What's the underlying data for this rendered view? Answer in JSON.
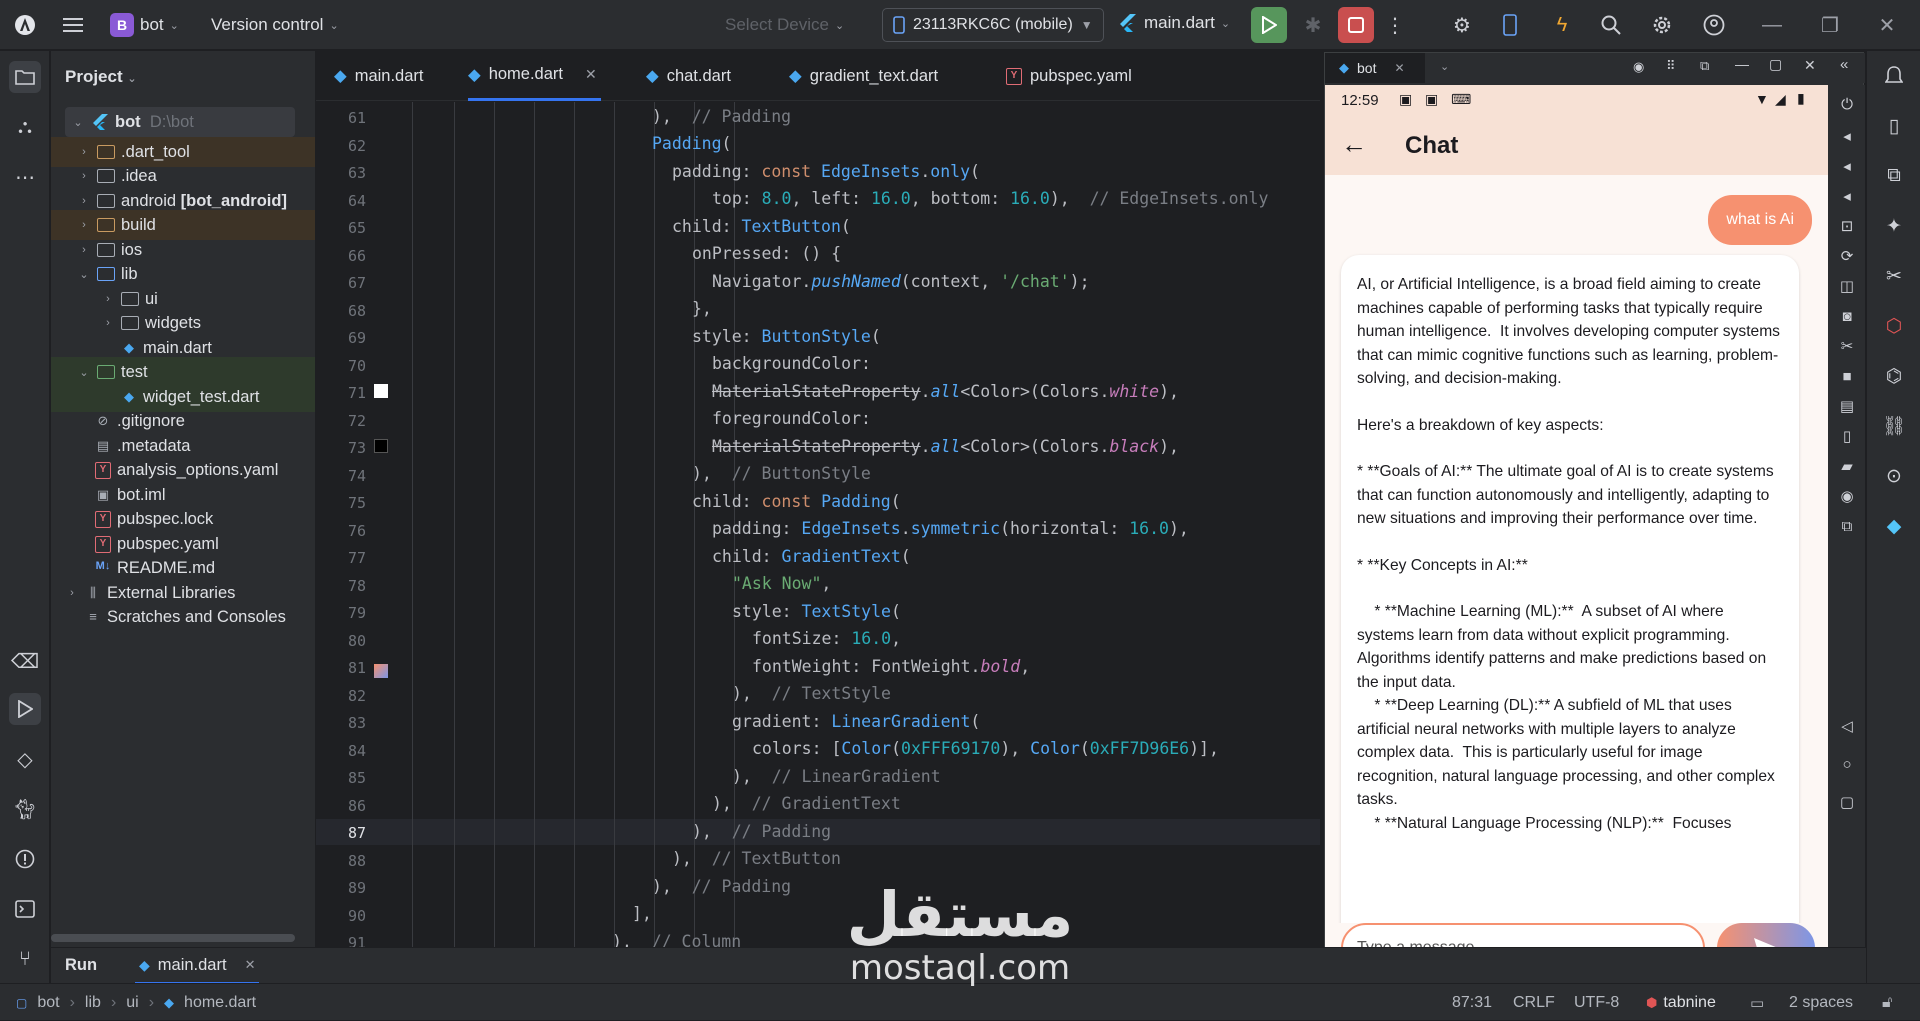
{
  "titlebar": {
    "project_letter": "B",
    "project_name": "bot",
    "vcs": "Version control",
    "select_device": "Select Device",
    "device": "23113RKC6C (mobile)",
    "run_config": "main.dart"
  },
  "project_panel": {
    "title": "Project",
    "root_name": "bot",
    "root_path": "D:\\bot",
    "items": [
      {
        "label": ".dart_tool"
      },
      {
        "label": ".idea"
      },
      {
        "label": "android",
        "suffix": "[bot_android]"
      },
      {
        "label": "build"
      },
      {
        "label": "ios"
      },
      {
        "label": "lib"
      },
      {
        "label": "ui"
      },
      {
        "label": "widgets"
      },
      {
        "label": "main.dart"
      },
      {
        "label": "test"
      },
      {
        "label": "widget_test.dart"
      },
      {
        "label": ".gitignore"
      },
      {
        "label": ".metadata"
      },
      {
        "label": "analysis_options.yaml"
      },
      {
        "label": "bot.iml"
      },
      {
        "label": "pubspec.lock"
      },
      {
        "label": "pubspec.yaml"
      },
      {
        "label": "README.md"
      },
      {
        "label": "External Libraries"
      },
      {
        "label": "Scratches and Consoles"
      }
    ]
  },
  "tabs": [
    {
      "label": "main.dart"
    },
    {
      "label": "home.dart"
    },
    {
      "label": "chat.dart"
    },
    {
      "label": "gradient_text.dart"
    },
    {
      "label": "pubspec.yaml"
    }
  ],
  "editor": {
    "line_numbers": [
      "61",
      "62",
      "63",
      "64",
      "65",
      "66",
      "67",
      "68",
      "69",
      "70",
      "71",
      "72",
      "73",
      "74",
      "75",
      "76",
      "77",
      "78",
      "79",
      "80",
      "81",
      "82",
      "83",
      "84",
      "85",
      "86",
      "87",
      "88",
      "89",
      "90",
      "91"
    ]
  },
  "emulator": {
    "tab_label": "bot",
    "time": "12:59",
    "app_title": "Chat",
    "user_message": "what is Ai",
    "ai_paragraphs": [
      "AI, or Artificial Intelligence, is a broad field aiming to create machines capable of performing tasks that typically require human intelligence.  It involves developing computer systems that can mimic cognitive functions such as learning, problem-solving, and decision-making.",
      "Here's a breakdown of key aspects:",
      "* **Goals of AI:** The ultimate goal of AI is to create systems that can function autonomously and intelligently, adapting to new situations and improving their performance over time.",
      "* **Key Concepts in AI:**",
      "    * **Machine Learning (ML):**  A subset of AI where systems learn from data without explicit programming. Algorithms identify patterns and make predictions based on the input data.\n    * **Deep Learning (DL):** A subfield of ML that uses artificial neural networks with multiple layers to analyze complex data.  This is particularly useful for image recognition, natural language processing, and other complex tasks.\n    * **Natural Language Processing (NLP):**  Focuses"
    ],
    "input_placeholder": "Type a message"
  },
  "runbar": {
    "label": "Run",
    "config": "main.dart"
  },
  "statusbar": {
    "crumbs": [
      "bot",
      "lib",
      "ui",
      "home.dart"
    ],
    "position": "87:31",
    "line_sep": "CRLF",
    "encoding": "UTF-8",
    "plugin": "tabnine",
    "indent": "2 spaces"
  },
  "watermark": {
    "arabic": "مستقل",
    "latin": "mostaql.com"
  },
  "colors": {
    "accent": "#3574f0",
    "run_green": "#57965c",
    "stop_red": "#c94f4f",
    "chat_orange": "#F69170",
    "chat_blue": "#7D96E6"
  }
}
